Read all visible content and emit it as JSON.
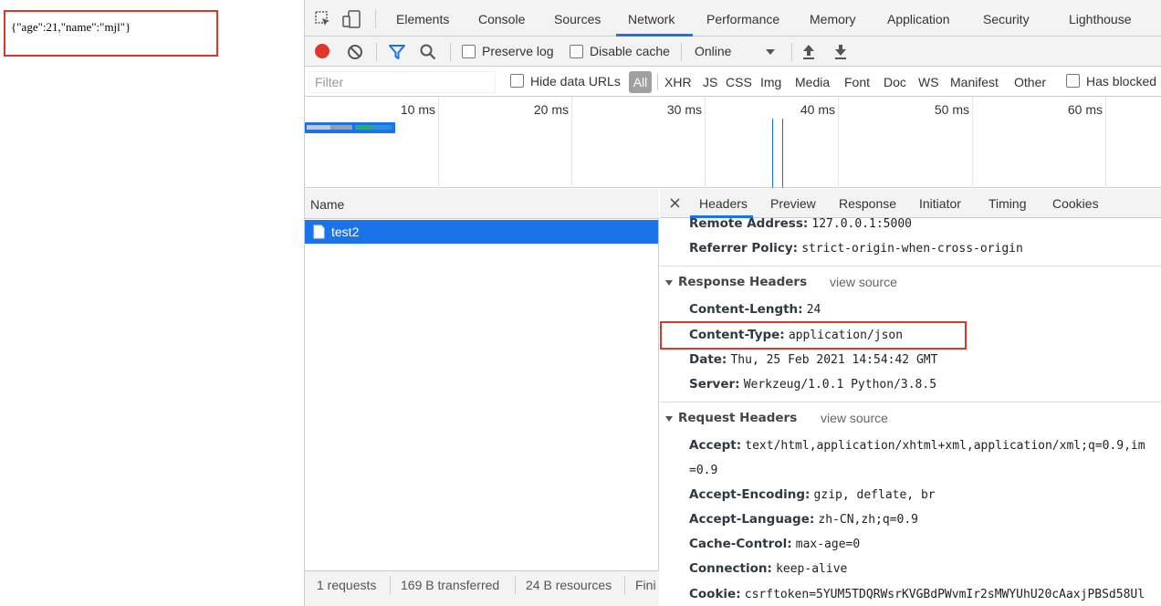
{
  "page": {
    "json_text": "{\"age\":21,\"name\":\"mjl\"}"
  },
  "devtools": {
    "tabs": [
      "Elements",
      "Console",
      "Sources",
      "Network",
      "Performance",
      "Memory",
      "Application",
      "Security",
      "Lighthouse"
    ],
    "active_tab": "Network",
    "toolbar": {
      "preserve_log": "Preserve log",
      "disable_cache": "Disable cache",
      "throttle_value": "Online"
    },
    "filter": {
      "placeholder": "Filter",
      "hide_data_urls": "Hide data URLs",
      "types": [
        "All",
        "XHR",
        "JS",
        "CSS",
        "Img",
        "Media",
        "Font",
        "Doc",
        "WS",
        "Manifest",
        "Other"
      ],
      "has_blocked": "Has blocked"
    },
    "overview": {
      "ticks": [
        "10 ms",
        "20 ms",
        "30 ms",
        "40 ms",
        "50 ms",
        "60 ms"
      ]
    },
    "requests": {
      "column_name": "Name",
      "rows": [
        {
          "name": "test2"
        }
      ]
    },
    "status": {
      "requests": "1 requests",
      "transferred": "169 B transferred",
      "resources": "24 B resources",
      "finish": "Fini"
    },
    "detail": {
      "tabs": [
        "Headers",
        "Preview",
        "Response",
        "Initiator",
        "Timing",
        "Cookies"
      ],
      "active_tab": "Headers",
      "general": [
        {
          "key": "Remote Address:",
          "value": "127.0.0.1:5000"
        },
        {
          "key": "Referrer Policy:",
          "value": "strict-origin-when-cross-origin"
        }
      ],
      "response_headers_title": "Response Headers",
      "response_view_source": "view source",
      "response_headers": [
        {
          "key": "Content-Length:",
          "value": "24"
        },
        {
          "key": "Content-Type:",
          "value": "application/json"
        },
        {
          "key": "Date:",
          "value": "Thu, 25 Feb 2021 14:54:42 GMT"
        },
        {
          "key": "Server:",
          "value": "Werkzeug/1.0.1 Python/3.8.5"
        }
      ],
      "request_headers_title": "Request Headers",
      "request_view_source": "view source",
      "request_headers": [
        {
          "key": "Accept:",
          "value": "text/html,application/xhtml+xml,application/xml;q=0.9,im"
        },
        {
          "key": "",
          "value": "=0.9"
        },
        {
          "key": "Accept-Encoding:",
          "value": "gzip, deflate, br"
        },
        {
          "key": "Accept-Language:",
          "value": "zh-CN,zh;q=0.9"
        },
        {
          "key": "Cache-Control:",
          "value": "max-age=0"
        },
        {
          "key": "Connection:",
          "value": "keep-alive"
        },
        {
          "key": "Cookie:",
          "value": "csrftoken=5YUM5TDQRWsrKVGBdPWvmIr2sMWYUhU20cAaxjPBSd58Ul"
        }
      ]
    },
    "colors": {
      "accent": "#1a73e8",
      "record": "#e0352b",
      "highlight_box": "#e0352b"
    }
  }
}
